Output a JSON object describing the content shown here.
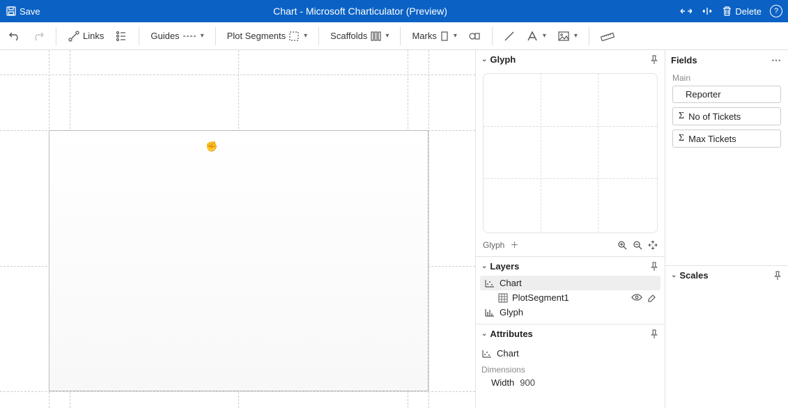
{
  "titlebar": {
    "save": "Save",
    "title": "Chart - Microsoft Charticulator (Preview)",
    "delete": "Delete"
  },
  "toolbar": {
    "links": "Links",
    "guides": "Guides",
    "plot_segments": "Plot Segments",
    "scaffolds": "Scaffolds",
    "marks": "Marks"
  },
  "panels": {
    "glyph_title": "Glyph",
    "glyph_label": "Glyph",
    "layers_title": "Layers",
    "attributes_title": "Attributes",
    "fields_title": "Fields",
    "scales_title": "Scales"
  },
  "layers": {
    "chart": "Chart",
    "plot_segment": "PlotSegment1",
    "glyph": "Glyph"
  },
  "attributes": {
    "chart": "Chart",
    "dimensions_label": "Dimensions",
    "width_label": "Width",
    "width_value": "900"
  },
  "fields": {
    "main_label": "Main",
    "reporter": "Reporter",
    "no_tickets": "No of Tickets",
    "max_tickets": "Max Tickets"
  }
}
